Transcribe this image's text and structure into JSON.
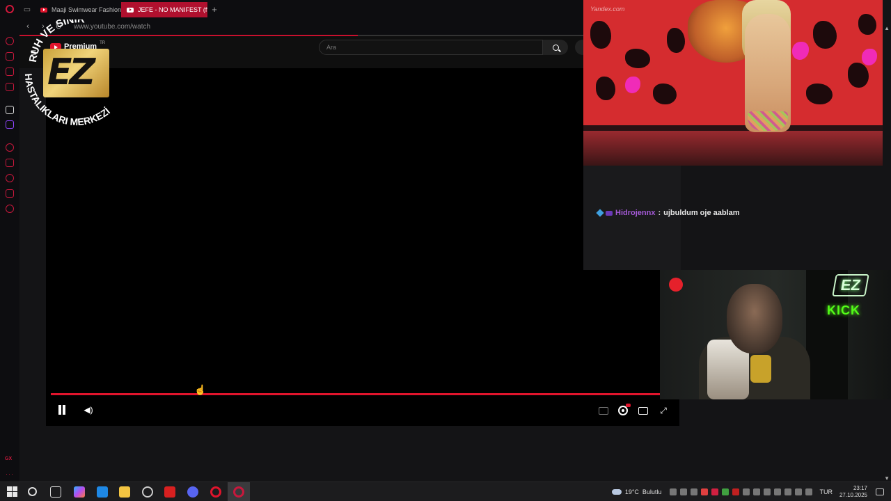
{
  "browser": {
    "tabs": [
      {
        "label": "Maaji Swimwear Fashion",
        "active": false
      },
      {
        "label": "JEFE - NO MANIFEST (ft.",
        "active": true
      }
    ],
    "new_tab_glyph": "+",
    "url": "www.youtube.com/watch",
    "sidebar_gx_label": "GX",
    "sidebar_more_label": "···"
  },
  "youtube": {
    "logo_text": "Premium",
    "logo_region": "TR",
    "search_placeholder": "Ara"
  },
  "player": {
    "playing": true,
    "progress_fraction": 1.0,
    "icons": [
      "pause-icon",
      "volume-icon",
      "subtitles-icon",
      "settings-icon",
      "miniplayer-icon",
      "fullscreen-icon"
    ]
  },
  "overlay": {
    "logo_ring_text_top": "RUH VE SİNİR",
    "logo_ring_text_bottom": "HASTALIKLARI MERKEZİ",
    "logo_letters": "EZ",
    "source_watermark": "Yandex.com"
  },
  "chat": {
    "username": "Hidrojennx",
    "separator": ":",
    "message": "ujbuldum oje aablam"
  },
  "webcam": {
    "neon_logo": "EZ",
    "neon_text": "KICK",
    "recording": true
  },
  "taskbar": {
    "weather_temp": "19°C",
    "weather_desc": "Bulutlu",
    "language": "TUR",
    "time": "23:17",
    "date": "27.10.2025"
  },
  "colors": {
    "accent": "#c8102e",
    "youtube_red": "#e0142c",
    "chat_user": "#a55ad8",
    "kick_green": "#53fc18"
  }
}
